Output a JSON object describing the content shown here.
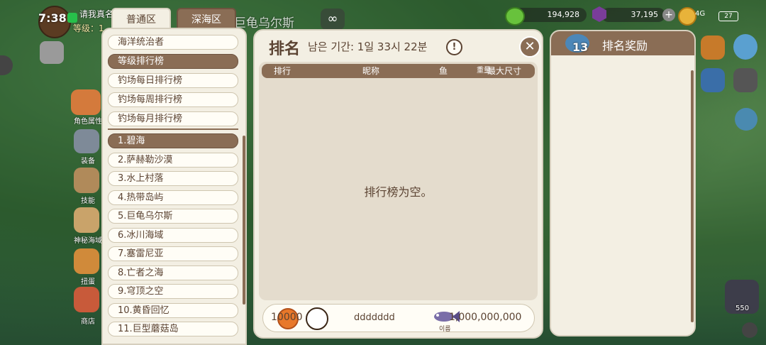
{
  "hud": {
    "time": "7:38",
    "player_name": "请我真名",
    "level_label": "等级：1",
    "region": "巨龟乌尔斯",
    "hearts": "194,928",
    "gems": "37,195",
    "network": "4G",
    "battery": "27",
    "gem_count_side": "550"
  },
  "side_labels": [
    "角色属性",
    "装备",
    "技能",
    "神秘海域",
    "扭蛋",
    "商店"
  ],
  "tabs": [
    "普通区",
    "深海区"
  ],
  "menu": {
    "top_items": [
      "海洋统治者",
      "等级排行榜",
      "钓场每日排行榜",
      "钓场每周排行榜",
      "钓场每月排行榜"
    ],
    "locations": [
      "1.碧海",
      "2.萨赫勒沙漠",
      "3.水上村落",
      "4.热带岛屿",
      "5.巨龟乌尔斯",
      "6.冰川海域",
      "7.塞雷尼亚",
      "8.亡者之海",
      "9.穹顶之空",
      "10.黄昏回忆",
      "11.巨型蘑菇岛"
    ]
  },
  "ranking": {
    "title": "排名",
    "period": "남은 기간: 1일 33시 22분",
    "info": "!",
    "close": "✕",
    "columns": {
      "rank": "排行",
      "nickname": "昵称",
      "fish": "鱼",
      "weight": "重量",
      "max": "最大尺寸"
    },
    "empty": "排行榜为空。",
    "my_row": {
      "rank": "10000",
      "nickname": "ddddddd",
      "fish_label": "이름",
      "score": "1,000,000,000"
    }
  },
  "rewards": {
    "title": "排名奖励",
    "badge": "13"
  },
  "colors": {
    "accent": "#8a6d55",
    "panel": "#f3efe3",
    "text": "#5b4332"
  }
}
